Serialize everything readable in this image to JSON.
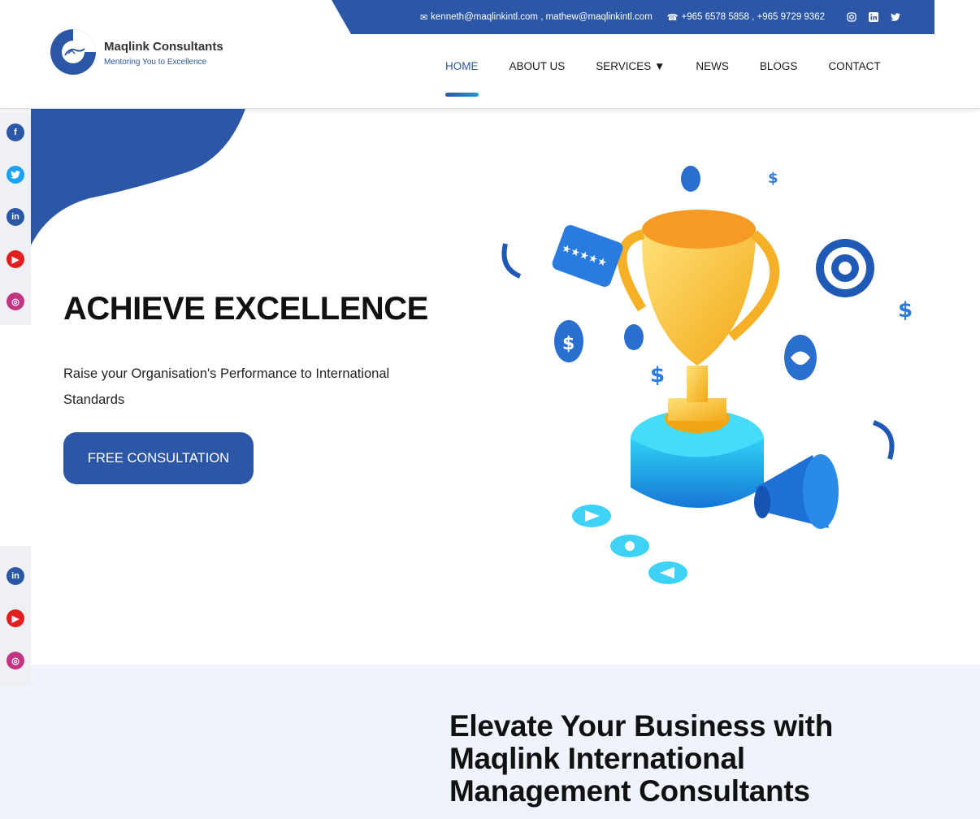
{
  "topbar": {
    "emails": "kenneth@maqlinkintl.com , mathew@maqlinkintl.com",
    "phones": "+965 6578 5858 , +965 9729 9362",
    "socials": [
      "instagram-icon",
      "linkedin-icon",
      "twitter-icon"
    ]
  },
  "brand": {
    "name": "Maqlink Consultants",
    "tagline": "Mentoring You to Excellence"
  },
  "nav": {
    "items": [
      {
        "label": "HOME",
        "active": true
      },
      {
        "label": "ABOUT US"
      },
      {
        "label": "SERVICES ▼"
      },
      {
        "label": "NEWS"
      },
      {
        "label": "BLOGS"
      },
      {
        "label": "CONTACT"
      }
    ]
  },
  "social_sidebar": {
    "icons": [
      "facebook-icon",
      "twitter-icon",
      "linkedin-icon",
      "youtube-icon",
      "instagram-icon"
    ],
    "colors": {
      "facebook": "#2c57a6",
      "twitter": "#1da1f2",
      "linkedin": "#2c57a6",
      "youtube": "#e02020",
      "instagram": "#c13584"
    }
  },
  "hero": {
    "title": "ACHIEVE EXCELLENCE",
    "subtitle": "Raise your Organisation's Performance to International Standards",
    "cta_label": "FREE CONSULTATION"
  },
  "section2": {
    "heading": "Elevate Your Business with Maqlink International Management Consultants"
  },
  "colors": {
    "brand_blue": "#2c57a6",
    "accent_light": "#1a9bd7",
    "section_bg": "#eef3fc"
  }
}
